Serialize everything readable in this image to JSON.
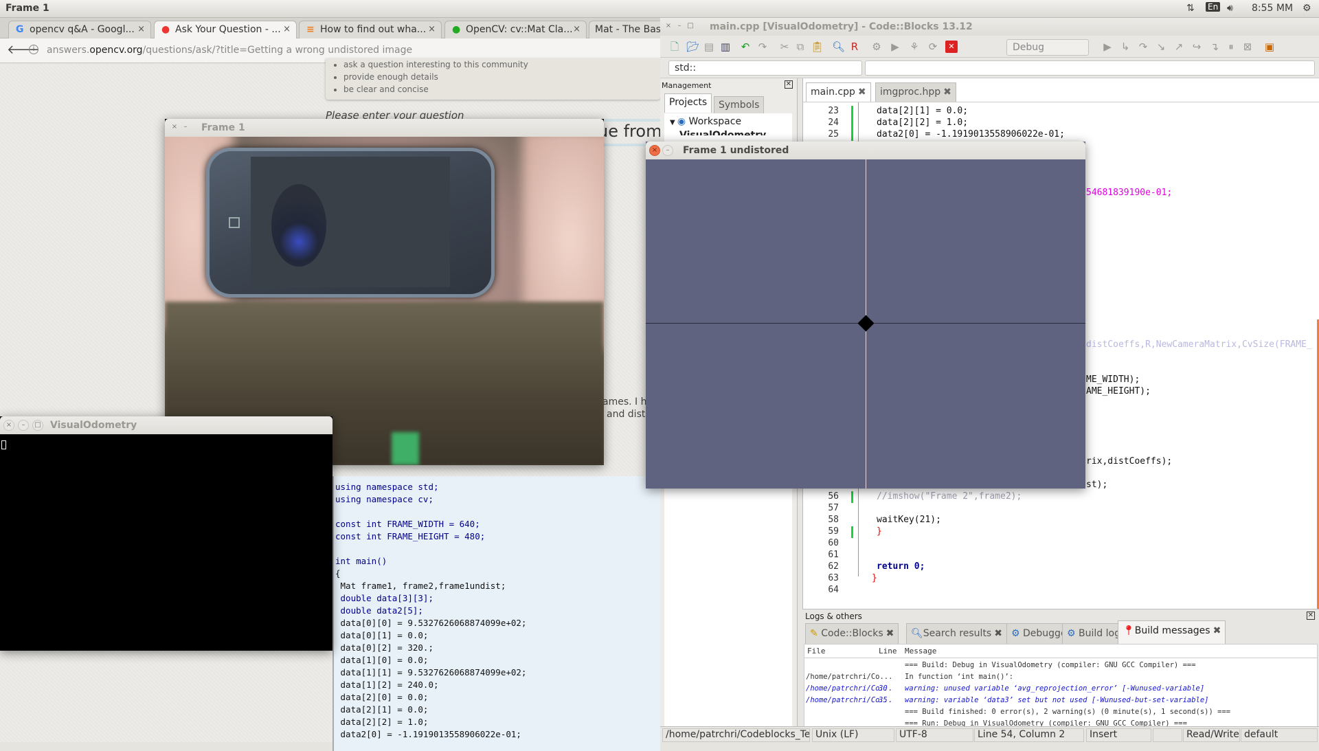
{
  "topbar": {
    "title": "Frame 1",
    "lang": "En",
    "time": "8:55 MM"
  },
  "browser": {
    "tabs": [
      {
        "label": "opencv q&A - Googl...",
        "icon": "G"
      },
      {
        "label": "Ask Your Question - ...",
        "icon": "opencv-logo",
        "active": true
      },
      {
        "label": "How to find out wha...",
        "icon": "stackoverflow-logo"
      },
      {
        "label": "OpenCV: cv::Mat Cla...",
        "icon": "opencv-logo"
      },
      {
        "label": "Mat - The Basic",
        "icon": ""
      }
    ],
    "tab_close": "×",
    "url_host_prefix": "answers.",
    "url_host": "opencv.org",
    "url_path": "/questions/ask/?title=Getting a wrong undistored image",
    "tips": [
      "ask a question interesting to this community",
      "provide enough details",
      "be clear and concise"
    ],
    "prompt": "Please enter your question",
    "title_fragment": "ue from",
    "body_fragments": [
      "ames. I ha",
      "and distC"
    ],
    "code": [
      "using namespace std;",
      "using namespace cv;",
      "",
      "const int FRAME_WIDTH = 640;",
      "const int FRAME_HEIGHT = 480;",
      "",
      "int main()",
      "{",
      " Mat frame1, frame2,frame1undist;",
      " double data[3][3];",
      " double data2[5];",
      " data[0][0] = 9.5327626068874099e+02;",
      " data[0][1] = 0.0;",
      " data[0][2] = 320.;",
      " data[1][0] = 0.0;",
      " data[1][1] = 9.5327626068874099e+02;",
      " data[1][2] = 240.0;",
      " data[2][0] = 0.0;",
      " data[2][1] = 0.0;",
      " data[2][2] = 1.0;",
      " data2[0] = -1.1919013558906022e-01;"
    ]
  },
  "windows": {
    "frame1_title": "Frame 1",
    "vo_title": "VisualOdometry",
    "undist_title": "Frame 1 undistored",
    "close": "×",
    "min": "–",
    "max": "□"
  },
  "codeblocks": {
    "title": "main.cpp [VisualOdometry] - Code::Blocks 13.12",
    "build_target": "Debug",
    "scope": "std::",
    "management": {
      "title": "Management",
      "tabs": [
        "Projects",
        "Symbols"
      ],
      "tree": [
        "Workspace",
        "VisualOdometry"
      ]
    },
    "editor_tabs": [
      "main.cpp",
      "imgproc.hpp"
    ],
    "lines": [
      {
        "n": "23",
        "text": "data[2][1] = 0.0;"
      },
      {
        "n": "24",
        "text": "data[2][2] = 1.0;"
      },
      {
        "n": "25",
        "text": "data2[0] = -1.1919013558906022e-01;"
      },
      {
        "n": "56",
        "text": "//imshow(\"Frame 2\",frame2);",
        "comment": true
      },
      {
        "n": "57",
        "text": ""
      },
      {
        "n": "58",
        "text": "waitKey(21);"
      },
      {
        "n": "59",
        "text": "}"
      },
      {
        "n": "60",
        "text": ""
      },
      {
        "n": "61",
        "text": ""
      },
      {
        "n": "62",
        "text": "return 0;"
      },
      {
        "n": "63",
        "text": "}"
      },
      {
        "n": "64",
        "text": ""
      }
    ],
    "fragments": [
      "54681839190e-01;",
      "distCoeffs,R,NewCameraMatrix,CvSize(FRAME_",
      "ME_WIDTH);",
      "AME_HEIGHT);",
      "rix,distCoeffs);",
      "st);"
    ],
    "logs": {
      "title": "Logs & others",
      "tabs": [
        "Code::Blocks",
        "Search results",
        "Debugger",
        "Build log",
        "Build messages"
      ],
      "columns": [
        "File",
        "Line",
        "Message"
      ],
      "rows": [
        {
          "file": "",
          "line": "",
          "msg": "=== Build: Debug in VisualOdometry (compiler: GNU GCC Compiler) ==="
        },
        {
          "file": "/home/patrchri/Co...",
          "line": "",
          "msg": "In function ‘int main()’:"
        },
        {
          "file": "/home/patrchri/Co...",
          "line": "30",
          "msg": "warning: unused variable ‘avg_reprojection_error’ [-Wunused-variable]",
          "warn": true
        },
        {
          "file": "/home/patrchri/Co...",
          "line": "35",
          "msg": "warning: variable ‘data3’ set but not used [-Wunused-but-set-variable]",
          "warn": true
        },
        {
          "file": "",
          "line": "",
          "msg": "=== Build finished: 0 error(s), 2 warning(s) (0 minute(s), 1 second(s)) ==="
        },
        {
          "file": "",
          "line": "",
          "msg": "=== Run: Debug in VisualOdometry (compiler: GNU GCC Compiler) ==="
        }
      ]
    },
    "status": [
      "/home/patrchri/Codeblocks_Te",
      "Unix (LF)",
      "UTF-8",
      "Line 54, Column 2",
      "Insert",
      "",
      "Read/Write",
      "default"
    ]
  },
  "colors": {
    "undistorted_bg": "#5f6380",
    "accent_orange": "#f07d44",
    "change_marker": "#19d23c",
    "warning_text": "#1515d0"
  }
}
